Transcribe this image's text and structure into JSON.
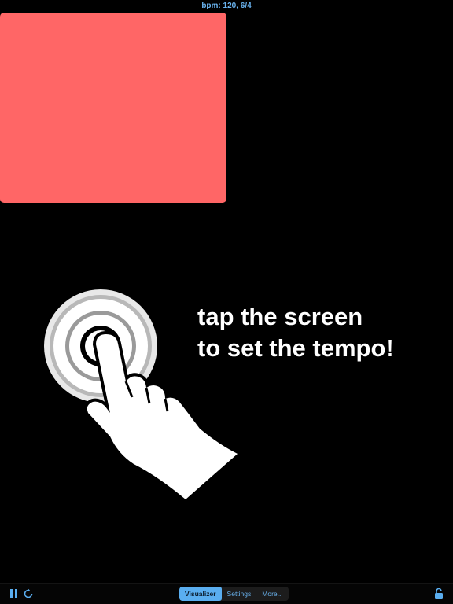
{
  "status": {
    "bpm_text": "bpm: 120, 6/4"
  },
  "visualizer": {
    "square_color": "#ff6666"
  },
  "hint": {
    "line1": "tap the screen",
    "line2": "to set the tempo!"
  },
  "toolbar": {
    "pause_icon": "pause-icon",
    "reset_icon": "refresh-icon",
    "lock_icon": "unlock-icon",
    "accent_color": "#5aaef0",
    "tabs": [
      {
        "label": "Visualizer",
        "active": true
      },
      {
        "label": "Settings",
        "active": false
      },
      {
        "label": "More...",
        "active": false
      }
    ]
  }
}
